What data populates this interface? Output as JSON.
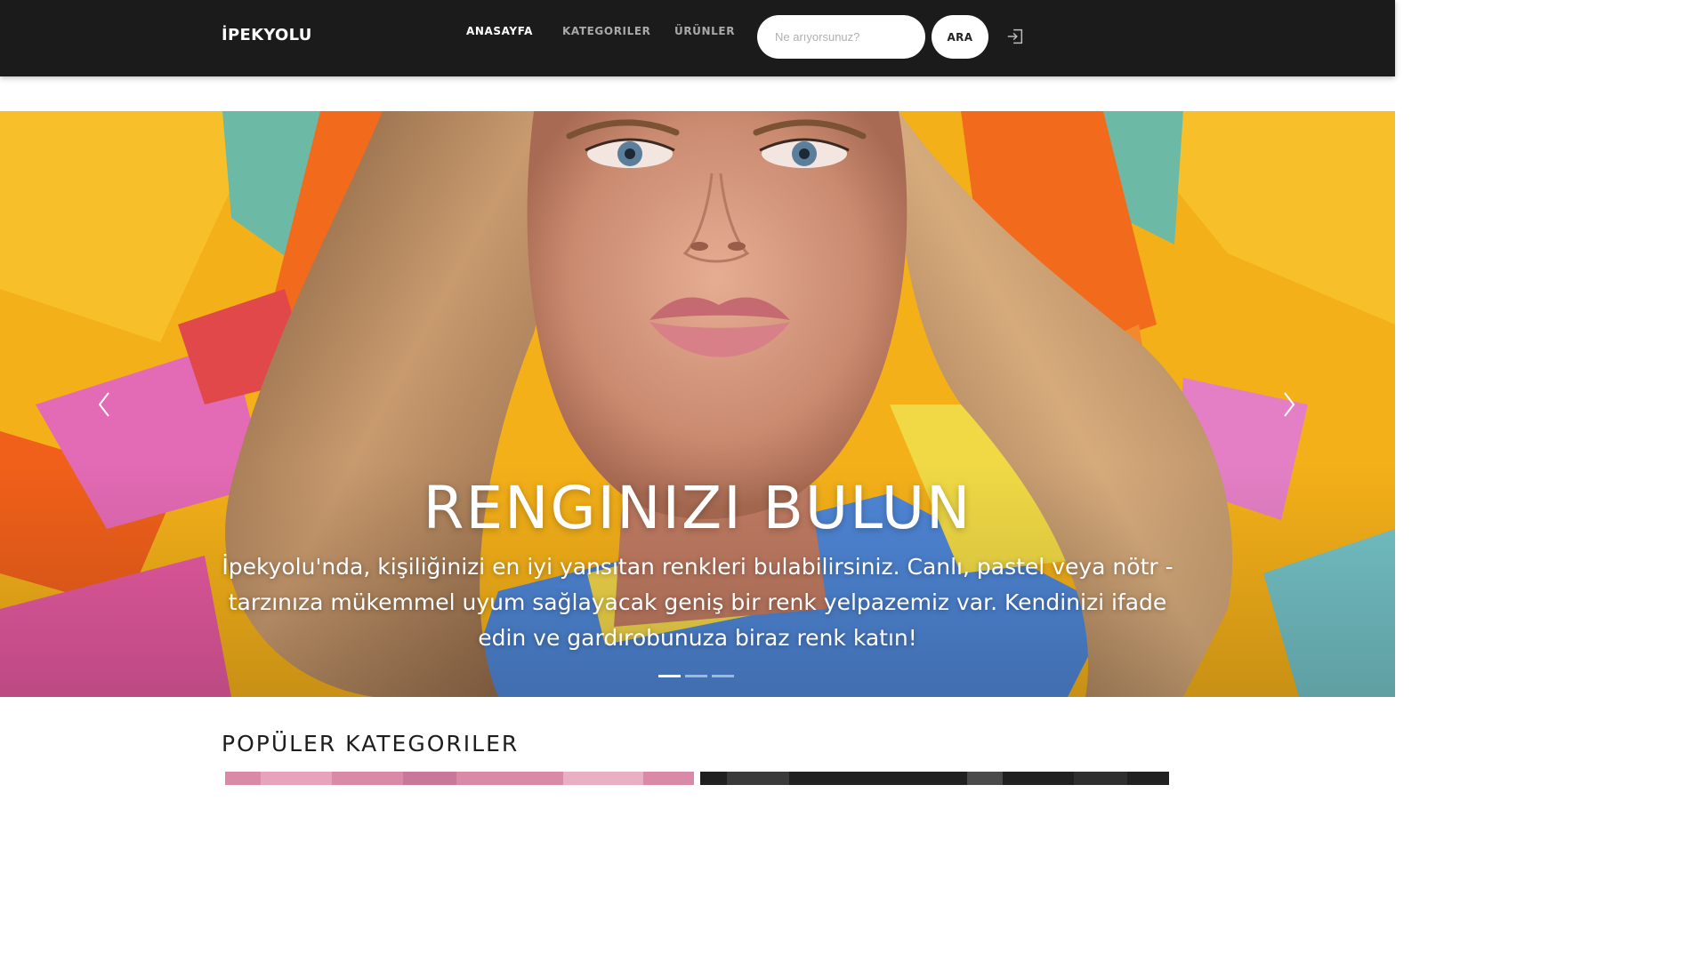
{
  "header": {
    "brand": "İPEKYOLU",
    "nav": {
      "home": "ANASAYFA",
      "categories": "KATEGORILER",
      "products": "ÜRÜNLER"
    },
    "search": {
      "placeholder": "Ne arıyorsunuz?",
      "button": "ARA"
    },
    "login_icon": "login-icon"
  },
  "hero": {
    "title": "RENGINIZI BULUN",
    "text": "İpekyolu'nda, kişiliğinizi en iyi yansıtan renkleri bulabilirsiniz. Canlı, pastel veya nötr - tarzınıza mükemmel uyum sağlayacak geniş bir renk yelpazemiz var. Kendinizi ifade edin ve gardırobunuza biraz renk katın!",
    "prev_icon": "chevron-left-icon",
    "next_icon": "chevron-right-icon",
    "slides": 3,
    "active_slide": 1
  },
  "popular": {
    "title": "POPÜLER KATEGORILER"
  },
  "colors": {
    "navbar": "#1b1b1b",
    "hero_yellow": "#f4b019",
    "accent_orange": "#f26a1b",
    "accent_blue": "#4f86d6"
  }
}
